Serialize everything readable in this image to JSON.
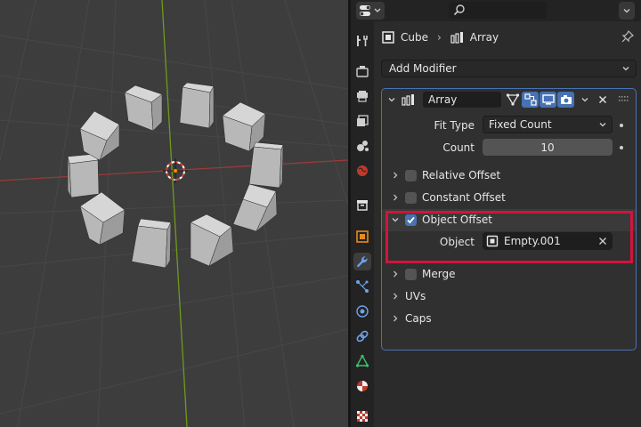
{
  "header": {
    "editor_type_icon": "properties-editor-icon",
    "search_placeholder": "",
    "search_icon": "search-icon",
    "options_icon": "chevron-down-icon"
  },
  "tabs": [
    {
      "name": "tool",
      "icon": "tool-icon"
    },
    {
      "name": "render",
      "icon": "render-icon"
    },
    {
      "name": "output",
      "icon": "output-icon"
    },
    {
      "name": "view-layer",
      "icon": "view-layer-icon"
    },
    {
      "name": "scene",
      "icon": "scene-icon"
    },
    {
      "name": "world",
      "icon": "world-icon"
    },
    {
      "name": "collection",
      "icon": "collection-icon"
    },
    {
      "name": "object",
      "icon": "object-icon"
    },
    {
      "name": "modifiers",
      "icon": "wrench-icon",
      "active": true
    },
    {
      "name": "particles",
      "icon": "particles-icon"
    },
    {
      "name": "physics",
      "icon": "physics-icon"
    },
    {
      "name": "constraints",
      "icon": "constraints-icon"
    },
    {
      "name": "data",
      "icon": "mesh-data-icon"
    },
    {
      "name": "material",
      "icon": "material-icon"
    },
    {
      "name": "texture",
      "icon": "texture-icon"
    }
  ],
  "breadcrumb": {
    "object": "Cube",
    "separator": "›",
    "modifier": "Array"
  },
  "add_modifier": {
    "label": "Add Modifier"
  },
  "modifier": {
    "name": "Array",
    "fit_type_label": "Fit Type",
    "fit_type_value": "Fixed Count",
    "count_label": "Count",
    "count_value": "10",
    "relative_offset_label": "Relative Offset",
    "relative_offset_enabled": false,
    "constant_offset_label": "Constant Offset",
    "constant_offset_enabled": false,
    "object_offset_label": "Object Offset",
    "object_offset_enabled": true,
    "object_label": "Object",
    "object_value": "Empty.001",
    "merge_label": "Merge",
    "merge_enabled": false,
    "uvs_label": "UVs",
    "caps_label": "Caps"
  },
  "colors": {
    "accent": "#4772b3",
    "highlight": "#d2143c",
    "x_axis": "#9b3a3a",
    "y_axis": "#6e9a1c"
  }
}
